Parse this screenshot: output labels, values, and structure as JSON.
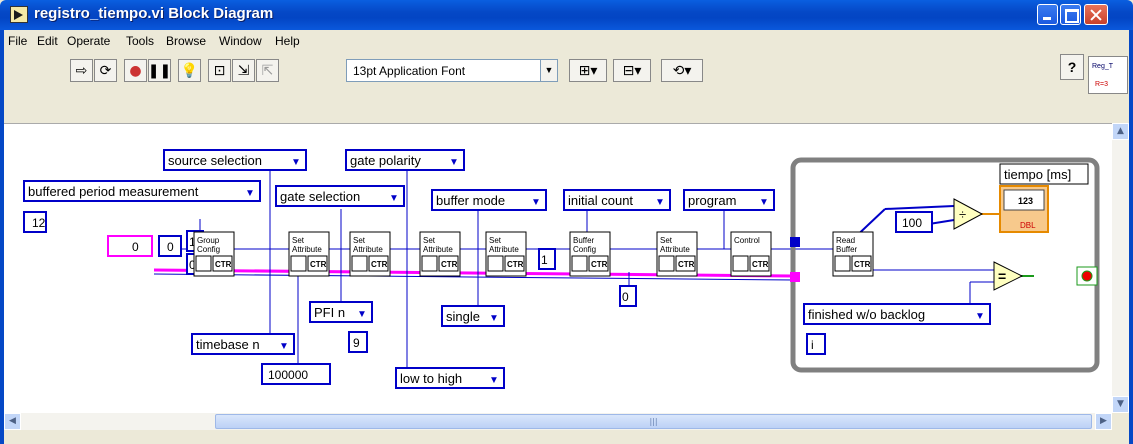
{
  "window": {
    "title": "registro_tiempo.vi Block Diagram"
  },
  "menu": [
    "File",
    "Edit",
    "Operate",
    "Tools",
    "Browse",
    "Window",
    "Help"
  ],
  "toolbar": {
    "font": "13pt Application Font",
    "help": "?"
  },
  "vi_icon": {
    "line1": "Reg_T",
    "line2": "R=3"
  },
  "constants": {
    "buffered_period": "buffered period measurement",
    "source_selection": "source selection",
    "gate_polarity": "gate polarity",
    "gate_selection": "gate selection",
    "buffer_mode": "buffer mode",
    "initial_count": "initial count",
    "program": "program",
    "timebase": "timebase n",
    "pfi": "PFI n",
    "single": "single",
    "low_to_high": "low to high",
    "finished": "finished w/o backlog",
    "tiempo": "tiempo [ms]",
    "n12": "12",
    "n0a": "0",
    "n0b": "0",
    "n1": "1",
    "n0c": "0",
    "n1b": "1",
    "n0d": "0",
    "n100000": "100000",
    "n9": "9",
    "n100": "100",
    "i_label": "i"
  },
  "subvis": [
    {
      "l1": "Group",
      "l2": "Config"
    },
    {
      "l1": "Set",
      "l2": "Attribute"
    },
    {
      "l1": "Set",
      "l2": "Attribute"
    },
    {
      "l1": "Set",
      "l2": "Attribute"
    },
    {
      "l1": "Set",
      "l2": "Attribute"
    },
    {
      "l1": "Buffer",
      "l2": "Config"
    },
    {
      "l1": "Set",
      "l2": "Attribute"
    },
    {
      "l1": "Control",
      "l2": ""
    },
    {
      "l1": "Read",
      "l2": "Buffer"
    }
  ],
  "ctr_label": "CTR",
  "indicator": {
    "type": "123",
    "dbl": "DBL"
  },
  "colors": {
    "wire_blue": "#0000c8",
    "wire_pink": "#ff00ff",
    "loop": "#808080",
    "orange": "#e68a00",
    "green": "#1b9a1b"
  }
}
